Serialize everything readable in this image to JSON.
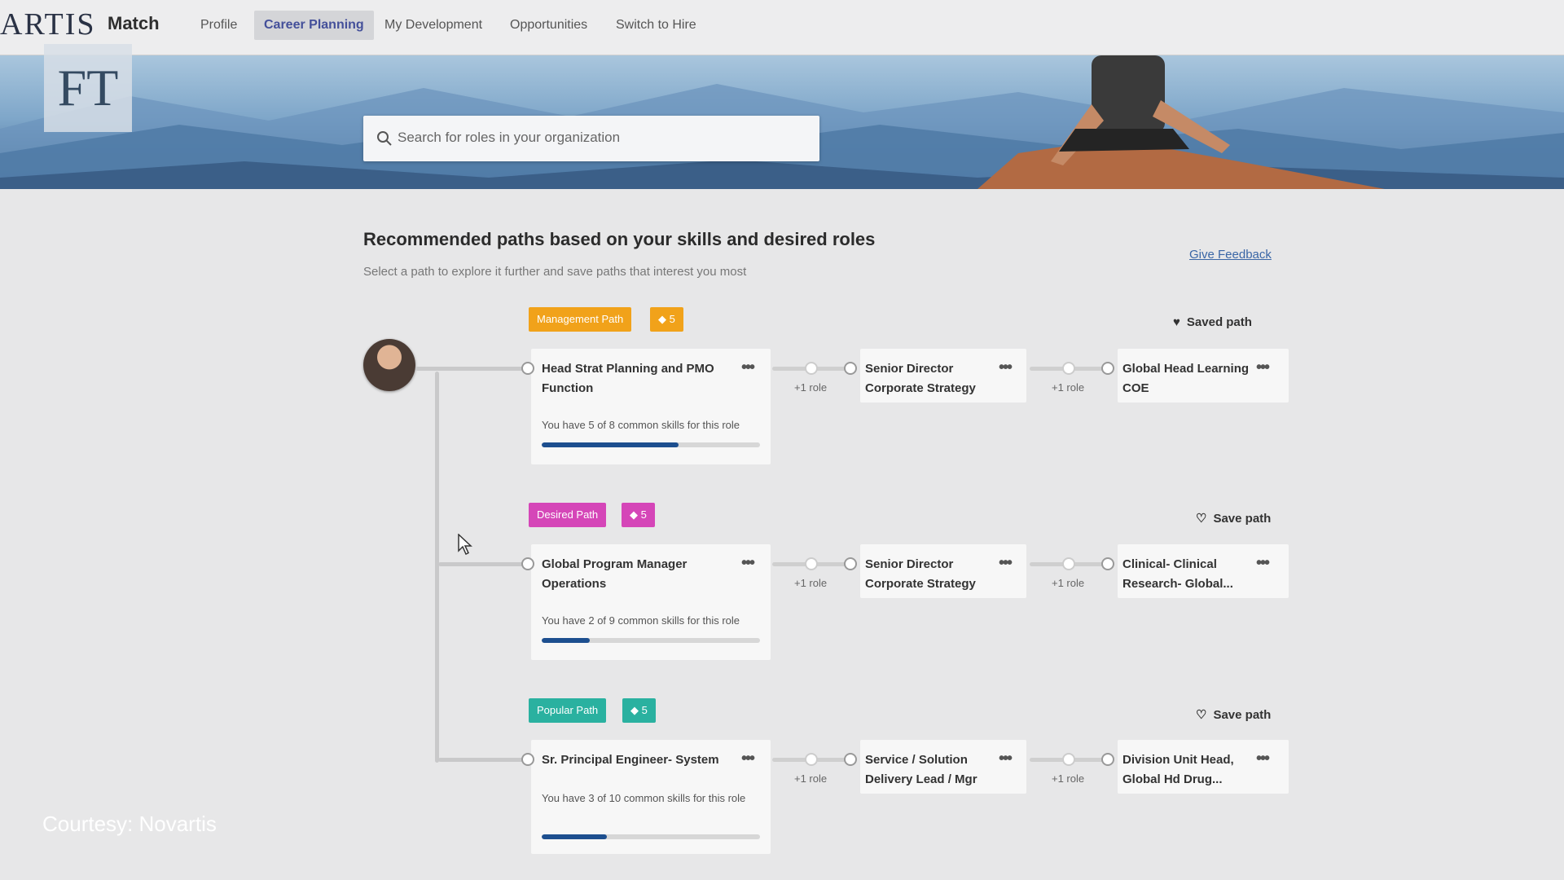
{
  "nav": {
    "brand_partial": "ARTIS",
    "app_name": "Match",
    "items": [
      {
        "label": "Profile"
      },
      {
        "label": "Career Planning",
        "active": true
      },
      {
        "label": "My Development"
      },
      {
        "label": "Opportunities"
      },
      {
        "label": "Switch to Hire"
      }
    ]
  },
  "search": {
    "placeholder": "Search for roles in your organization",
    "icon": "search-icon"
  },
  "overlay": {
    "ft_logo": "FT",
    "credit": "Courtesy: Novartis"
  },
  "section": {
    "title": "Recommended paths based on your skills and desired roles",
    "subtitle": "Select a path to explore it further and save paths that interest you most",
    "feedback": "Give Feedback"
  },
  "paths": [
    {
      "tag": "Management Path",
      "tag_color": "#f1a21a",
      "count": "5",
      "count_color": "#f1a21a",
      "save_label": "Saved path",
      "saved": true,
      "role1": "Head Strat Planning and PMO Function",
      "skills_text": "You have 5 of 8 common skills for this role",
      "skills_fraction": 0.625,
      "plus1": "+1 role",
      "role2": "Senior Director Corporate Strategy",
      "plus2": "+1 role",
      "role3": "Global Head Learning COE"
    },
    {
      "tag": "Desired Path",
      "tag_color": "#d546b8",
      "count": "5",
      "count_color": "#d546b8",
      "save_label": "Save path",
      "saved": false,
      "role1": "Global Program Manager Operations",
      "skills_text": "You have 2 of 9 common skills for this role",
      "skills_fraction": 0.222,
      "plus1": "+1 role",
      "role2": "Senior Director Corporate Strategy",
      "plus2": "+1 role",
      "role3": "Clinical- Clinical Research- Global..."
    },
    {
      "tag": "Popular Path",
      "tag_color": "#2ab1a0",
      "count": "5",
      "count_color": "#2ab1a0",
      "save_label": "Save path",
      "saved": false,
      "role1": "Sr. Principal Engineer- System",
      "skills_text": "You have 3 of 10 common skills for this role",
      "skills_fraction": 0.3,
      "plus1": "+1 role",
      "role2": "Service / Solution Delivery Lead / Mgr",
      "plus2": "+1 role",
      "role3": "Division Unit Head, Global Hd Drug..."
    }
  ],
  "more_icon": "more-horizontal-icon"
}
